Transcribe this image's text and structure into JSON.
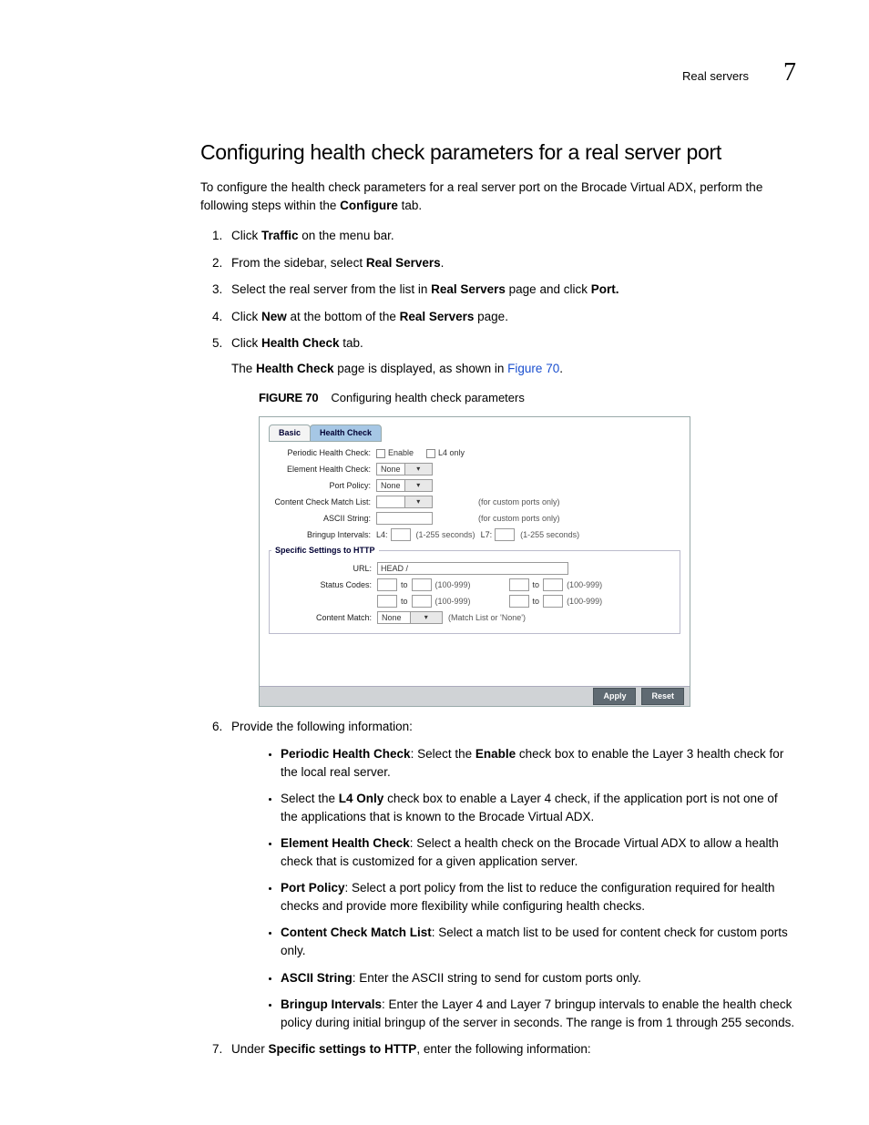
{
  "header": {
    "section": "Real servers",
    "chapter": "7"
  },
  "title": "Configuring health check parameters for a real server port",
  "intro": {
    "pre": "To configure the health check parameters for a real server port on the Brocade Virtual ADX, perform the following steps within the ",
    "bold": "Configure",
    "post": " tab."
  },
  "steps": {
    "s1": {
      "pre": "Click ",
      "b": "Traffic",
      "post": " on the menu bar."
    },
    "s2": {
      "pre": "From the sidebar, select ",
      "b": "Real Servers",
      "post": "."
    },
    "s3": {
      "pre": "Select the real server from the list in ",
      "b1": "Real Servers",
      "mid": " page and click ",
      "b2": "Port."
    },
    "s4": {
      "pre": "Click ",
      "b1": "New",
      "mid": " at the bottom of the ",
      "b2": "Real Servers",
      "post": " page."
    },
    "s5": {
      "pre": "Click ",
      "b": "Health Check",
      "post": " tab."
    },
    "s5sub": {
      "pre": "The ",
      "b": "Health Check",
      "mid": " page is displayed, as shown in ",
      "link": "Figure 70",
      "post": "."
    },
    "s6": "Provide the following information:",
    "s7": {
      "pre": "Under ",
      "b": "Specific settings to HTTP",
      "post": ", enter the following information:"
    }
  },
  "figcap": {
    "label": "FIGURE 70",
    "text": "Configuring health check parameters"
  },
  "figure": {
    "tabs": {
      "basic": "Basic",
      "hc": "Health Check"
    },
    "rows": {
      "phc_label": "Periodic Health Check:",
      "phc_enable": "Enable",
      "phc_l4": "L4 only",
      "ehc_label": "Element Health Check:",
      "ehc_val": "None",
      "pp_label": "Port Policy:",
      "pp_val": "None",
      "ccml_label": "Content Check Match List:",
      "ccml_note": "(for custom ports only)",
      "ascii_label": "ASCII String:",
      "ascii_note": "(for custom ports only)",
      "bi_label": "Bringup Intervals:",
      "bi_l4": "L4:",
      "bi_hint1": "(1-255 seconds)",
      "bi_l7": "L7:",
      "bi_hint2": "(1-255 seconds)"
    },
    "http": {
      "legend": "Specific Settings to HTTP",
      "url_label": "URL:",
      "url_val": "HEAD /",
      "sc_label": "Status Codes:",
      "to": "to",
      "range": "(100-999)",
      "cm_label": "Content Match:",
      "cm_val": "None",
      "cm_hint": "(Match List or 'None')"
    },
    "buttons": {
      "apply": "Apply",
      "reset": "Reset"
    }
  },
  "bullets": {
    "b1": {
      "b": "Periodic Health Check",
      "mid": ": Select the ",
      "b2": "Enable",
      "post": " check box to enable the Layer 3 health check for the local real server."
    },
    "b2": {
      "pre": "Select the ",
      "b": "L4 Only",
      "post": " check box to enable a Layer 4 check, if the application port is not one of the applications that is known to the Brocade Virtual ADX."
    },
    "b3": {
      "b": "Element Health Check",
      "post": ": Select a health check on the Brocade Virtual ADX to allow a health check that is customized for a given application server."
    },
    "b4": {
      "b": "Port Policy",
      "post": ": Select a port policy from the list to reduce the configuration required for health checks and provide more flexibility while configuring health checks."
    },
    "b5": {
      "b": "Content Check Match List",
      "post": ": Select a match list to be used for content check for custom ports only."
    },
    "b6": {
      "b": "ASCII String",
      "post": ": Enter the ASCII string to send for custom ports only."
    },
    "b7": {
      "b": "Bringup Intervals",
      "post": ": Enter the Layer 4 and Layer 7 bringup intervals to enable the health check policy during initial bringup of the server in seconds. The range is from 1 through 255 seconds."
    }
  }
}
